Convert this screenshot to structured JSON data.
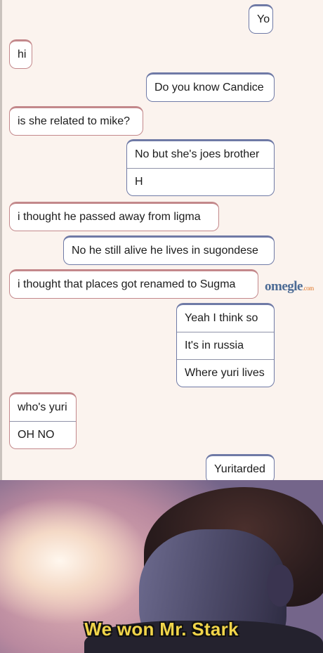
{
  "chat": {
    "messages": [
      {
        "sender": "me",
        "lines": [
          "Yo"
        ]
      },
      {
        "sender": "stranger",
        "lines": [
          "hi"
        ]
      },
      {
        "sender": "me",
        "lines": [
          "Do you know Candice"
        ]
      },
      {
        "sender": "stranger",
        "lines": [
          "is she related to mike?"
        ]
      },
      {
        "sender": "me",
        "lines": [
          "No but she's joes brother",
          "H"
        ]
      },
      {
        "sender": "stranger",
        "lines": [
          "i thought he passed away from ligma"
        ]
      },
      {
        "sender": "me",
        "lines": [
          "No he still alive he lives in sugondese"
        ]
      },
      {
        "sender": "stranger",
        "lines": [
          "i thought that places got renamed to Sugma"
        ]
      },
      {
        "sender": "me",
        "lines": [
          "Yeah I think so",
          "It's in russia",
          "Where yuri lives"
        ]
      },
      {
        "sender": "stranger",
        "lines": [
          "who's yuri",
          "OH NO"
        ]
      },
      {
        "sender": "me",
        "lines": [
          "Yuritarded"
        ]
      }
    ]
  },
  "logo": {
    "name": "omegle",
    "suffix": ".com"
  },
  "meme": {
    "caption": "We won Mr. Stark"
  },
  "colors": {
    "me_border": "#6f7aa6",
    "stranger_border": "#c3888b",
    "caption": "#f1d54a"
  }
}
